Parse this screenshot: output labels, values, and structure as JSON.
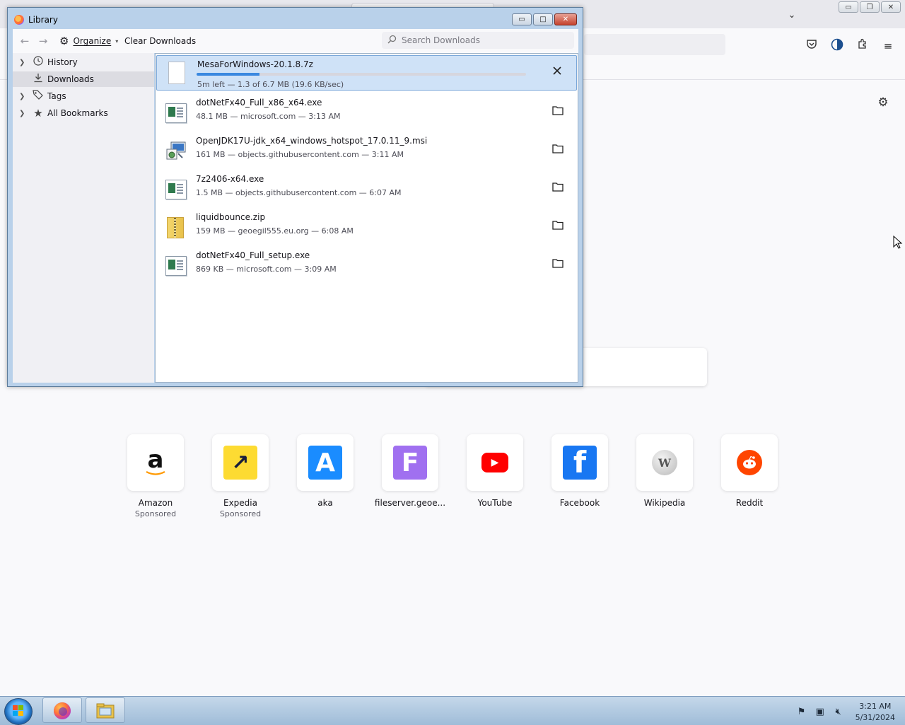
{
  "firefox": {
    "newtab": {
      "topsites": [
        {
          "label": "Amazon",
          "sub": "Sponsored",
          "logo_icon": "amazon-logo",
          "logo_text": "a",
          "color": "#ffffff"
        },
        {
          "label": "Expedia",
          "sub": "Sponsored",
          "logo_icon": "expedia-logo",
          "logo_text": "↗",
          "color": "#fddb32"
        },
        {
          "label": "aka",
          "sub": "",
          "logo_icon": "aka-logo",
          "logo_text": "A",
          "color": "#1a8cff"
        },
        {
          "label": "fileserver.geoe...",
          "sub": "",
          "logo_icon": "fileserver-logo",
          "logo_text": "F",
          "color": "#a070f0"
        },
        {
          "label": "YouTube",
          "sub": "",
          "logo_icon": "youtube-logo",
          "logo_text": "▶",
          "color": "#ff0000"
        },
        {
          "label": "Facebook",
          "sub": "",
          "logo_icon": "facebook-logo",
          "logo_text": "f",
          "color": "#1877f2"
        },
        {
          "label": "Wikipedia",
          "sub": "",
          "logo_icon": "wikipedia-logo",
          "logo_text": "W",
          "color": "#c8c8c8"
        },
        {
          "label": "Reddit",
          "sub": "",
          "logo_icon": "reddit-logo",
          "logo_text": "●",
          "color": "#ff4500"
        }
      ]
    }
  },
  "library": {
    "title": "Library",
    "window_buttons": {
      "minimize": "▭",
      "maximize": "□",
      "close": "✕"
    },
    "toolbar": {
      "organize_label": "Organize",
      "clear_downloads_label": "Clear Downloads",
      "search_placeholder": "Search Downloads"
    },
    "sidebar": {
      "items": [
        {
          "label": "History",
          "icon": "clock-icon",
          "expandable": true,
          "selected": false
        },
        {
          "label": "Downloads",
          "icon": "download-icon",
          "expandable": false,
          "selected": true
        },
        {
          "label": "Tags",
          "icon": "tag-icon",
          "expandable": true,
          "selected": false
        },
        {
          "label": "All Bookmarks",
          "icon": "star-icon",
          "expandable": true,
          "selected": false
        }
      ]
    },
    "downloads": [
      {
        "name": "MesaForWindows-20.1.8.7z",
        "meta": "5m left — 1.3 of 6.7 MB (19.6 KB/sec)",
        "progress": 0.19,
        "status": "downloading",
        "icon": "blank-file-icon",
        "action_icon": "cancel-icon"
      },
      {
        "name": "dotNetFx40_Full_x86_x64.exe",
        "meta": "48.1 MB — microsoft.com — 3:13 AM",
        "status": "done",
        "icon": "exe-file-icon",
        "action_icon": "folder-icon"
      },
      {
        "name": "OpenJDK17U-jdk_x64_windows_hotspot_17.0.11_9.msi",
        "meta": "161 MB — objects.githubusercontent.com — 3:11 AM",
        "status": "done",
        "icon": "msi-installer-icon",
        "action_icon": "folder-icon"
      },
      {
        "name": "7z2406-x64.exe",
        "meta": "1.5 MB — objects.githubusercontent.com — 6:07 AM",
        "status": "done",
        "icon": "exe-file-icon",
        "action_icon": "folder-icon"
      },
      {
        "name": "liquidbounce.zip",
        "meta": "159 MB — geoegil555.eu.org — 6:08 AM",
        "status": "done",
        "icon": "zip-file-icon",
        "action_icon": "folder-icon"
      },
      {
        "name": "dotNetFx40_Full_setup.exe",
        "meta": "869 KB — microsoft.com — 3:09 AM",
        "status": "done",
        "icon": "exe-file-icon",
        "action_icon": "folder-icon"
      }
    ]
  },
  "taskbar": {
    "clock_time": "3:21 AM",
    "clock_date": "5/31/2024",
    "apps": [
      {
        "name": "Firefox",
        "icon": "firefox-icon"
      },
      {
        "name": "Windows Explorer",
        "icon": "explorer-folder-icon"
      }
    ]
  }
}
